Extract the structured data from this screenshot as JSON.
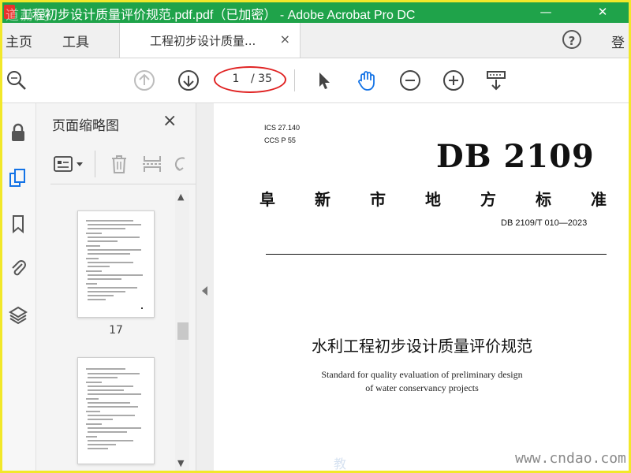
{
  "window": {
    "title": "工程初步设计质量评价规范.pdf.pdf（已加密） - Adobe Acrobat Pro DC",
    "watermark": "道赫网",
    "controls": {
      "minimize": "—",
      "close": "✕"
    }
  },
  "menubar": {
    "home": "主页",
    "tools": "工具",
    "tab_label": "工程初步设计质量...",
    "tab_close": "×",
    "help": "?",
    "login": "登"
  },
  "toolbar": {
    "page_current": "1",
    "page_total": "/ 35"
  },
  "thumbnails_panel": {
    "title": "页面缩略图",
    "close": "×",
    "thumbs": [
      {
        "label": "17"
      },
      {
        "label": ""
      }
    ]
  },
  "document": {
    "ics": "ICS  27.140",
    "ccs": "CCS  P  55",
    "db_code": "DB 2109",
    "standard_name": [
      "阜",
      "新",
      "市",
      "地",
      "方",
      "标",
      "准"
    ],
    "standard_number": "DB 2109/T 010—2023",
    "title_cn": "水利工程初步设计质量评价规范",
    "title_en_line1": "Standard for quality evaluation of preliminary design",
    "title_en_line2": "of water conservancy projects"
  },
  "watermarks": {
    "bottom_right": "www.cndao.com",
    "faint": "教"
  },
  "colors": {
    "titlebar": "#1fa34a",
    "frame": "#f2e82a",
    "highlight_ellipse": "#e02222",
    "accent_blue": "#1473e6"
  }
}
